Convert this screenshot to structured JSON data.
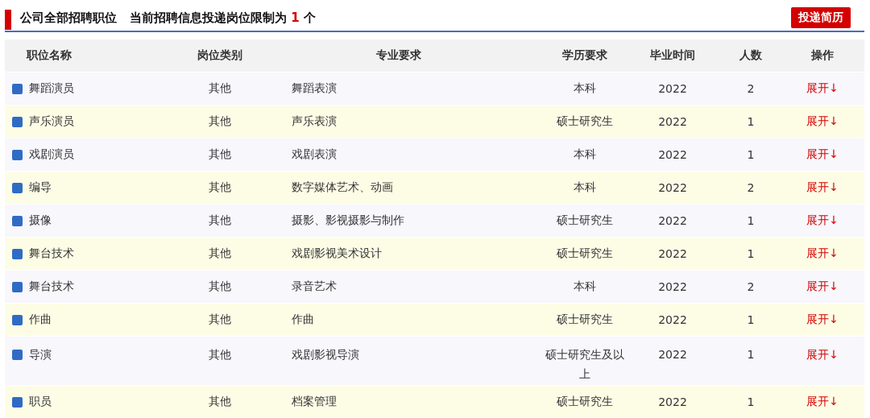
{
  "header": {
    "title": "公司全部招聘职位",
    "limit": {
      "prefix": "当前招聘信息投递岗位限制为",
      "count": "1",
      "suffix": "个"
    },
    "button": "投递简历"
  },
  "table": {
    "columns": [
      "职位名称",
      "岗位类别",
      "专业要求",
      "学历要求",
      "毕业时间",
      "人数",
      "操作"
    ],
    "rows": [
      {
        "name": "舞蹈演员",
        "category": "其他",
        "major": "舞蹈表演",
        "education": "本科",
        "graduation": "2022",
        "count": "2",
        "action": "展开↓"
      },
      {
        "name": "声乐演员",
        "category": "其他",
        "major": "声乐表演",
        "education": "硕士研究生",
        "graduation": "2022",
        "count": "1",
        "action": "展开↓"
      },
      {
        "name": "戏剧演员",
        "category": "其他",
        "major": "戏剧表演",
        "education": "本科",
        "graduation": "2022",
        "count": "1",
        "action": "展开↓"
      },
      {
        "name": "编导",
        "category": "其他",
        "major": "数字媒体艺术、动画",
        "education": "本科",
        "graduation": "2022",
        "count": "2",
        "action": "展开↓"
      },
      {
        "name": "摄像",
        "category": "其他",
        "major": "摄影、影视摄影与制作",
        "education": "硕士研究生",
        "graduation": "2022",
        "count": "1",
        "action": "展开↓"
      },
      {
        "name": "舞台技术",
        "category": "其他",
        "major": "戏剧影视美术设计",
        "education": "硕士研究生",
        "graduation": "2022",
        "count": "1",
        "action": "展开↓"
      },
      {
        "name": "舞台技术",
        "category": "其他",
        "major": "录音艺术",
        "education": "本科",
        "graduation": "2022",
        "count": "2",
        "action": "展开↓"
      },
      {
        "name": "作曲",
        "category": "其他",
        "major": "作曲",
        "education": "硕士研究生",
        "graduation": "2022",
        "count": "1",
        "action": "展开↓"
      },
      {
        "name": "导演",
        "category": "其他",
        "major": "戏剧影视导演",
        "education": "硕士研究生及以上",
        "graduation": "2022",
        "count": "1",
        "action": "展开↓"
      },
      {
        "name": "职员",
        "category": "其他",
        "major": "档案管理",
        "education": "硕士研究生",
        "graduation": "2022",
        "count": "1",
        "action": "展开↓"
      }
    ]
  }
}
